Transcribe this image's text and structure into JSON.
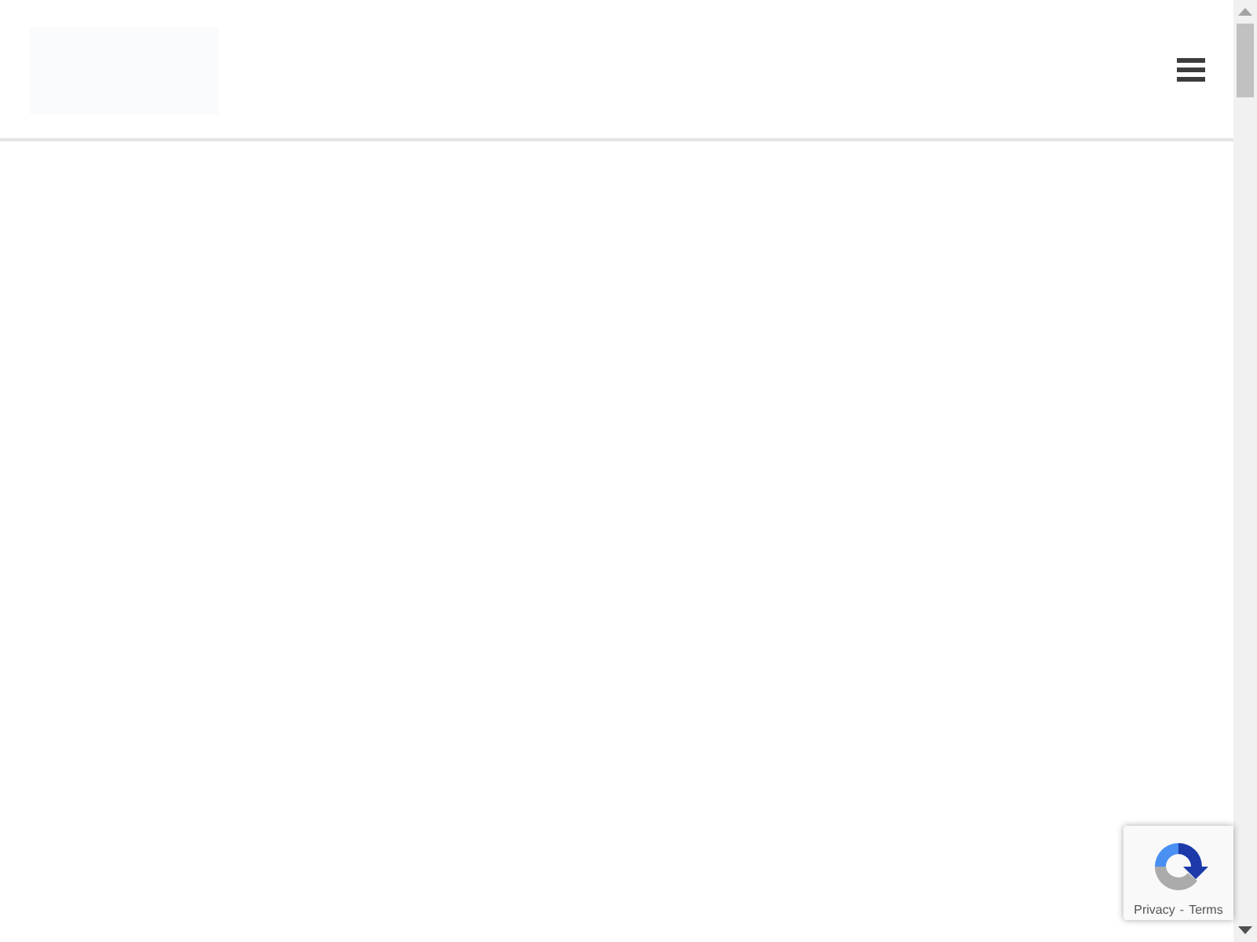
{
  "recaptcha": {
    "links": [
      "Privacy",
      "Terms"
    ],
    "separator": "-"
  }
}
